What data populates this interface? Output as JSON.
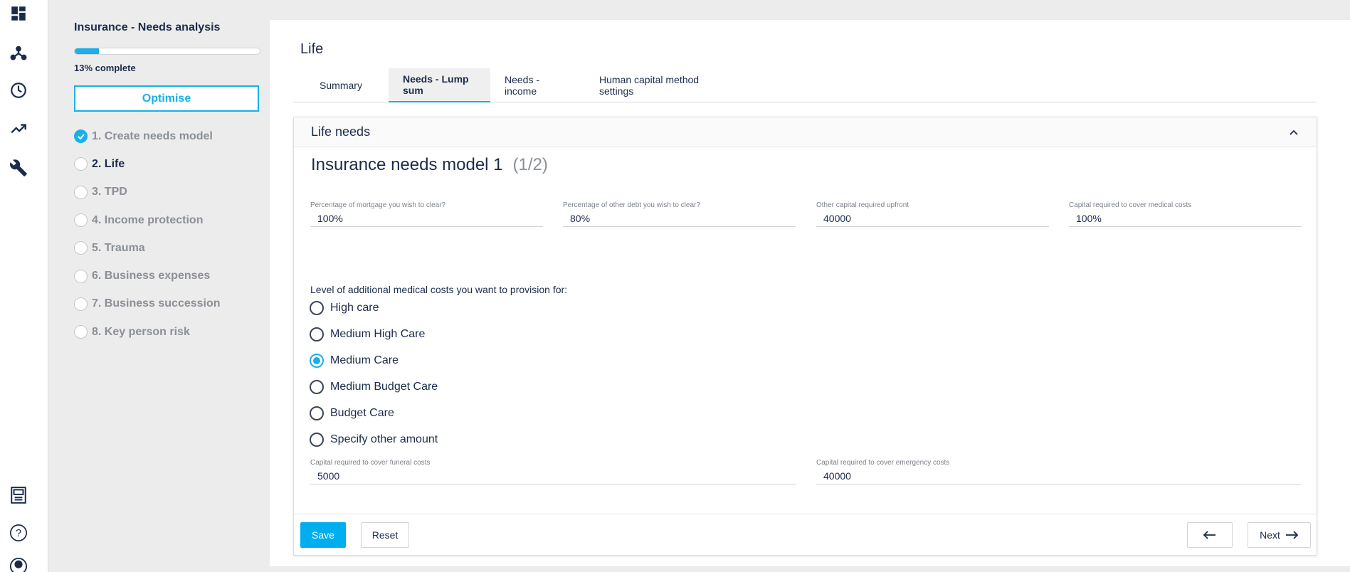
{
  "rail": {
    "icons": [
      "dashboard-icon",
      "network-icon",
      "clock-icon",
      "trending-up-icon",
      "wrench-icon",
      "calculator-icon",
      "help-icon",
      "user-icon"
    ],
    "help_glyph": "?"
  },
  "sidebar": {
    "title": "Insurance - Needs analysis",
    "progress_percent": 13,
    "progress_text": "13% complete",
    "optimise_label": "Optimise",
    "steps": [
      {
        "label": "1. Create needs model",
        "state": "done"
      },
      {
        "label": "2. Life",
        "state": "current"
      },
      {
        "label": "3. TPD",
        "state": "pending"
      },
      {
        "label": "4. Income protection",
        "state": "pending"
      },
      {
        "label": "5. Trauma",
        "state": "pending"
      },
      {
        "label": "6. Business expenses",
        "state": "pending"
      },
      {
        "label": "7. Business succession",
        "state": "pending"
      },
      {
        "label": "8. Key person risk",
        "state": "pending"
      }
    ]
  },
  "main": {
    "title": "Life",
    "tabs": [
      {
        "label": "Summary",
        "active": false
      },
      {
        "label": "Needs - Lump sum",
        "active": true
      },
      {
        "label": "Needs - income",
        "active": false
      },
      {
        "label": "Human capital method settings",
        "active": false
      }
    ],
    "card": {
      "header": "Life needs",
      "model_title": "Insurance needs model 1",
      "model_count": "(1/2)",
      "fields_row1": [
        {
          "label": "Percentage of mortgage you wish to clear?",
          "value": "100%"
        },
        {
          "label": "Percentage of other debt you wish to clear?",
          "value": "80%"
        },
        {
          "label": "Other capital required upfront",
          "value": "40000"
        },
        {
          "label": "Capital required to cover medical costs",
          "value": "100%"
        }
      ],
      "medical_question": "Level of additional medical costs you want to provision for:",
      "medical_options": [
        {
          "label": "High care",
          "checked": false
        },
        {
          "label": "Medium High Care",
          "checked": false
        },
        {
          "label": "Medium Care",
          "checked": true
        },
        {
          "label": "Medium Budget Care",
          "checked": false
        },
        {
          "label": "Budget Care",
          "checked": false
        },
        {
          "label": "Specify other amount",
          "checked": false
        }
      ],
      "fields_row2": [
        {
          "label": "Capital required to cover funeral costs",
          "value": "5000"
        },
        {
          "label": "Capital required to cover emergency costs",
          "value": "40000"
        }
      ]
    },
    "footer": {
      "save_label": "Save",
      "reset_label": "Reset",
      "next_label": "Next"
    }
  },
  "colors": {
    "accent": "#1ab0e8",
    "save_button": "#00aef0",
    "text": "#1c2b4a",
    "muted": "#8b8f97"
  }
}
